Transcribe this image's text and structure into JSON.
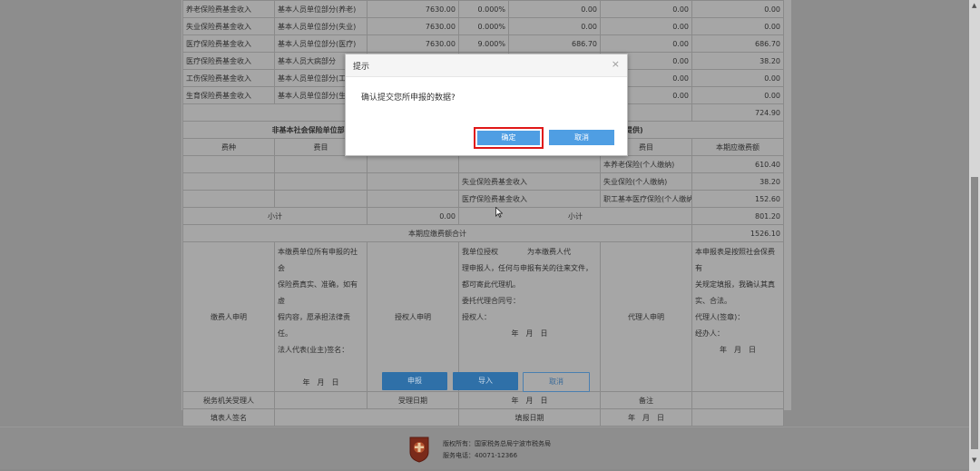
{
  "top_rows": [
    {
      "fee_type": "养老保险费基金收入",
      "item": "基本人员单位部分(养老)",
      "base": "7630.00",
      "rate": "0.000%",
      "amount": "0.00",
      "c6": "0.00",
      "c7": "0.00"
    },
    {
      "fee_type": "失业保险费基金收入",
      "item": "基本人员单位部分(失业)",
      "base": "7630.00",
      "rate": "0.000%",
      "amount": "0.00",
      "c6": "0.00",
      "c7": "0.00"
    },
    {
      "fee_type": "医疗保险费基金收入",
      "item": "基本人员单位部分(医疗)",
      "base": "7630.00",
      "rate": "9.000%",
      "amount": "686.70",
      "c6": "0.00",
      "c7": "686.70"
    },
    {
      "fee_type": "医疗保险费基金收入",
      "item": "基本人员大病部分",
      "base": "7630.00",
      "rate": "0.500%",
      "amount": "38.20",
      "c6": "0.00",
      "c7": "38.20"
    },
    {
      "fee_type": "工伤保险费基金收入",
      "item": "基本人员单位部分(工伤)",
      "base": "",
      "rate": "",
      "amount": "",
      "c6": "0.00",
      "c7": "0.00"
    },
    {
      "fee_type": "生育保险费基金收入",
      "item": "基本人员单位部分(生育)",
      "base": "",
      "rate": "",
      "amount": "",
      "c6": "0.00",
      "c7": "0.00"
    }
  ],
  "top_total": "724.90",
  "section_left": "非基本社会保险单位部分(由税",
  "section_right": "保部门提供)",
  "sub_headers": {
    "fee_type": "费种",
    "item": "费目",
    "item2": "费目",
    "amount_due": "本期应缴费额"
  },
  "personal_rows": [
    {
      "fee_type": "",
      "item": "本养老保险(个人缴纳)",
      "amount": "610.40"
    },
    {
      "fee_type": "失业保险费基金收入",
      "item": "失业保险(个人缴纳)",
      "amount": "38.20"
    },
    {
      "fee_type": "医疗保险费基金收入",
      "item": "职工基本医疗保险(个人缴纳)",
      "amount": "152.60"
    }
  ],
  "subtotal_label": "小计",
  "subtotal_left": "0.00",
  "subtotal_right": "801.20",
  "grand_total_label": "本期应缴费额合计",
  "grand_total": "1526.10",
  "declare": {
    "payer_label": "缴费人申明",
    "payer_text": [
      "本缴费单位所有申报的社会",
      "保险费真实、准确，如有虚",
      "假内容，愿承担法律责任。",
      "法人代表(业主)签名：",
      "",
      "年　月　日"
    ],
    "authorize_label": "授权人申明",
    "authorize_text": [
      "我单位授权　　　　为本缴费人代",
      "理申报人，任何与申报有关的往来文件，",
      "都可寄此代理机。",
      "委托代理合同号：",
      "授权人：",
      "年　月　日"
    ],
    "agent_label": "代理人申明",
    "agent_text": [
      "本申报表是按照社会保费有",
      "关规定填报，我确认其真",
      "实、合法。",
      "代理人(签章)：",
      "经办人：",
      "年　月　日"
    ]
  },
  "tax_receiver_label": "税务机关受理人",
  "accept_date_label": "受理日期",
  "accept_date_value": "年　月　日",
  "note_label": "备注",
  "filler_label": "填表人签名",
  "fill_date_label": "填报日期",
  "fill_date_value": "年　月　日",
  "buttons": {
    "submit": "申报",
    "import": "导入",
    "cancel": "取消"
  },
  "dialog": {
    "title": "提示",
    "close": "×",
    "message": "确认提交您所申报的数据?",
    "ok": "确定",
    "cancel": "取消"
  },
  "footer": {
    "line1": "版权所有：国家税务总局宁波市税务局",
    "line2": "服务电话：40071-12366"
  },
  "colors": {
    "ok_highlight": "#e01818",
    "dialog_button": "#4f9ee3",
    "page_button": "#2f70a8"
  }
}
